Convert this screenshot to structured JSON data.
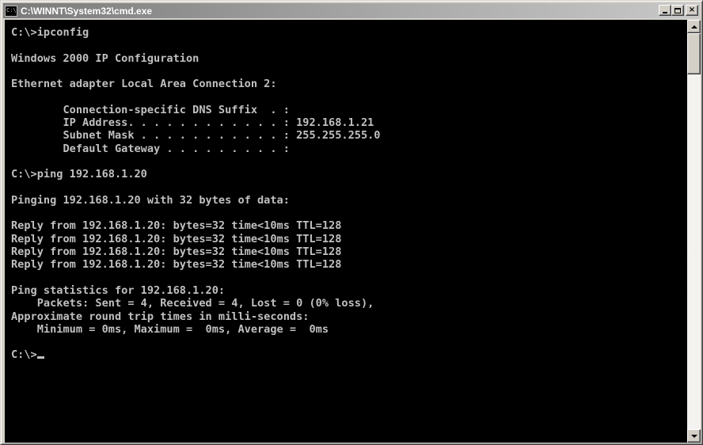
{
  "window": {
    "title": "C:\\WINNT\\System32\\cmd.exe",
    "icon": "cmd-console-icon",
    "icon_text": "C:\\",
    "buttons": {
      "minimize": "minimize-icon",
      "maximize": "maximize-icon",
      "close_label": "×"
    }
  },
  "console": {
    "lines": [
      "C:\\>ipconfig",
      "",
      "Windows 2000 IP Configuration",
      "",
      "Ethernet adapter Local Area Connection 2:",
      "",
      "        Connection-specific DNS Suffix  . :",
      "        IP Address. . . . . . . . . . . . : 192.168.1.21",
      "        Subnet Mask . . . . . . . . . . . : 255.255.255.0",
      "        Default Gateway . . . . . . . . . :",
      "",
      "C:\\>ping 192.168.1.20",
      "",
      "Pinging 192.168.1.20 with 32 bytes of data:",
      "",
      "Reply from 192.168.1.20: bytes=32 time<10ms TTL=128",
      "Reply from 192.168.1.20: bytes=32 time<10ms TTL=128",
      "Reply from 192.168.1.20: bytes=32 time<10ms TTL=128",
      "Reply from 192.168.1.20: bytes=32 time<10ms TTL=128",
      "",
      "Ping statistics for 192.168.1.20:",
      "    Packets: Sent = 4, Received = 4, Lost = 0 (0% loss),",
      "Approximate round trip times in milli-seconds:",
      "    Minimum = 0ms, Maximum =  0ms, Average =  0ms",
      "",
      "C:\\>"
    ]
  },
  "colors": {
    "console_background": "#000000",
    "console_text": "#c0c0c0",
    "title_text": "#ffffff",
    "window_chrome": "#d4d0c8"
  }
}
